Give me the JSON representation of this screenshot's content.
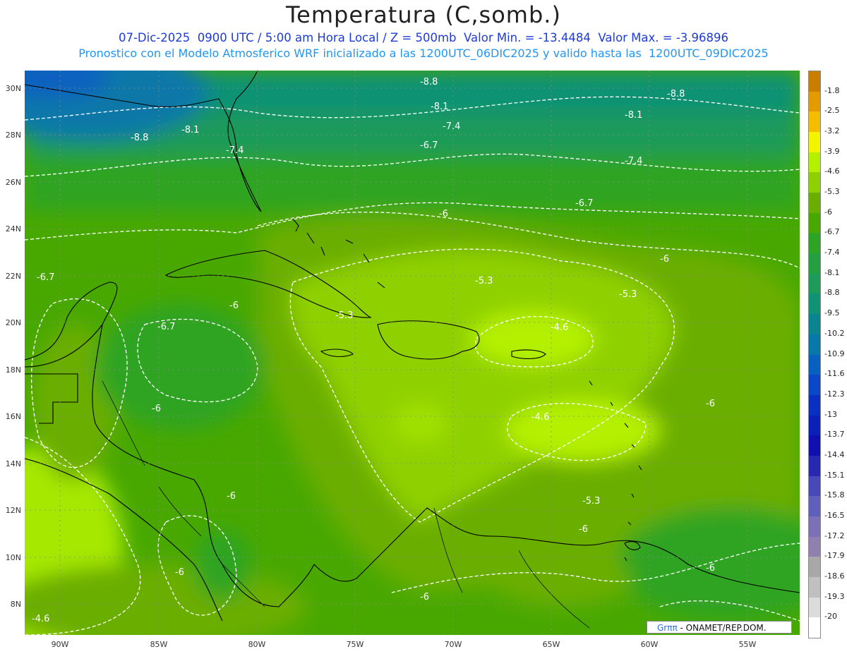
{
  "header": {
    "title": "Temperatura (C,somb.)",
    "subtitle_1": "07-Dic-2025  0900 UTC / 5:00 am Hora Local / Z = 500mb  Valor Min. = -13.4484  Valor Max. = -3.96896",
    "subtitle_2": "Pronostico con el Modelo Atmosferico WRF inicializado a las 1200UTC_06DIC2025 y valido hasta las  1200UTC_09DIC2025"
  },
  "axes": {
    "lat_labels": [
      "30N",
      "28N",
      "26N",
      "24N",
      "22N",
      "20N",
      "18N",
      "16N",
      "14N",
      "12N",
      "10N",
      "8N"
    ],
    "lon_labels": [
      "90W",
      "85W",
      "80W",
      "75W",
      "70W",
      "65W",
      "60W",
      "55W"
    ]
  },
  "colorbar": {
    "labels": [
      "-1.8",
      "-2.5",
      "-3.2",
      "-3.9",
      "-4.6",
      "-5.3",
      "-6",
      "-6.7",
      "-7.4",
      "-8.1",
      "-8.8",
      "-9.5",
      "-10.2",
      "-10.9",
      "-11.6",
      "-12.3",
      "-13",
      "-13.7",
      "-14.4",
      "-15.1",
      "-15.8",
      "-16.5",
      "-17.2",
      "-17.9",
      "-18.6",
      "-19.3",
      "-20"
    ],
    "colors": [
      "#c87f00",
      "#e39b00",
      "#f5bd00",
      "#f4f400",
      "#b4f000",
      "#8fd000",
      "#6aae00",
      "#48a800",
      "#2ea424",
      "#25a040",
      "#1e9a5a",
      "#109274",
      "#0a8590",
      "#0878a8",
      "#0860c0",
      "#0a48c8",
      "#0a30c0",
      "#0a20b8",
      "#1010b0",
      "#2828b0",
      "#4848b8",
      "#6060bc",
      "#7c70b8",
      "#9080b0",
      "#a8a8a8",
      "#c0c0c0",
      "#dcdcdc",
      "#ffffff"
    ]
  },
  "contours": {
    "labels": [
      "-8.8",
      "-8.8",
      "-8.1",
      "-8.1",
      "-8.1",
      "-8.8",
      "-7.4",
      "-6.7",
      "-7.4",
      "-7.4",
      "-6.7",
      "-6",
      "-6",
      "-6.7",
      "-5.3",
      "-5.3",
      "-5.3",
      "-6",
      "-6.7",
      "-4.6",
      "-6",
      "-4.6",
      "-6",
      "-6",
      "-5.3",
      "-6",
      "-6",
      "-6",
      "-6",
      "-4.6"
    ]
  },
  "credit": {
    "logo": "Grππ",
    "text": "- ONAMET/REP.DOM."
  }
}
